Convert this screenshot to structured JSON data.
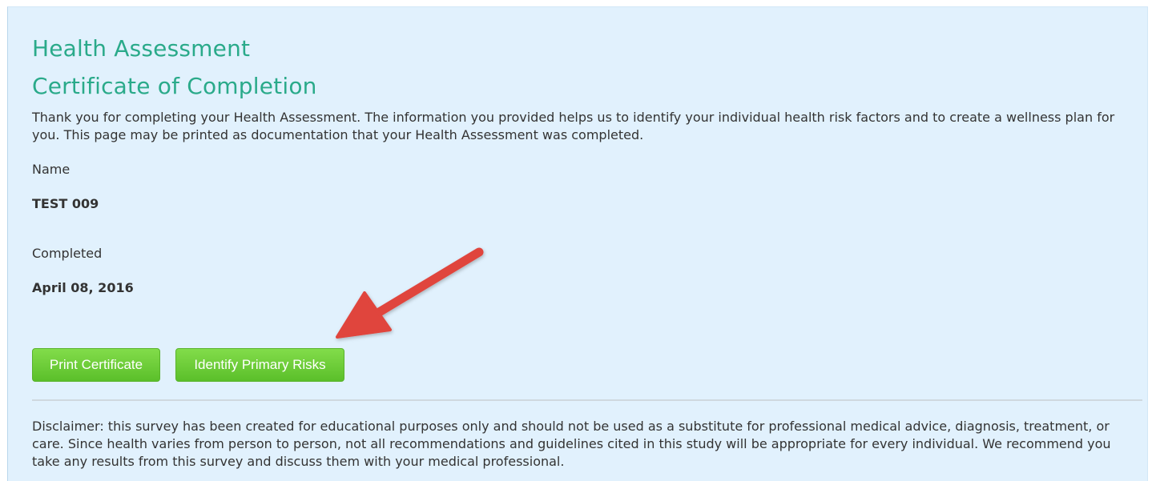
{
  "header": {
    "title": "Health Assessment",
    "subtitle": "Certificate of Completion"
  },
  "intro_text": "Thank you for completing your Health Assessment. The information you provided helps us to identify your individual health risk factors and to create a wellness plan for you. This page may be printed as documentation that your Health Assessment was completed.",
  "fields": {
    "name_label": "Name",
    "name_value": "TEST 009",
    "completed_label": "Completed",
    "completed_value": "April 08, 2016"
  },
  "buttons": {
    "print_label": "Print Certificate",
    "risks_label": "Identify Primary Risks"
  },
  "disclaimer": "Disclaimer: this survey has been created for educational purposes only and should not be used as a substitute for professional medical advice, diagnosis, treatment, or care. Since health varies from person to person, not all recommendations and guidelines cited in this study will be appropriate for every individual. We recommend you take any results from this survey and discuss them with your medical professional.",
  "colors": {
    "panel_background": "#e1f1fd",
    "heading": "#2aaa8a",
    "button": "#6acb38",
    "annotation_arrow": "#e0443c"
  },
  "annotation": {
    "icon": "red-arrow-icon"
  }
}
